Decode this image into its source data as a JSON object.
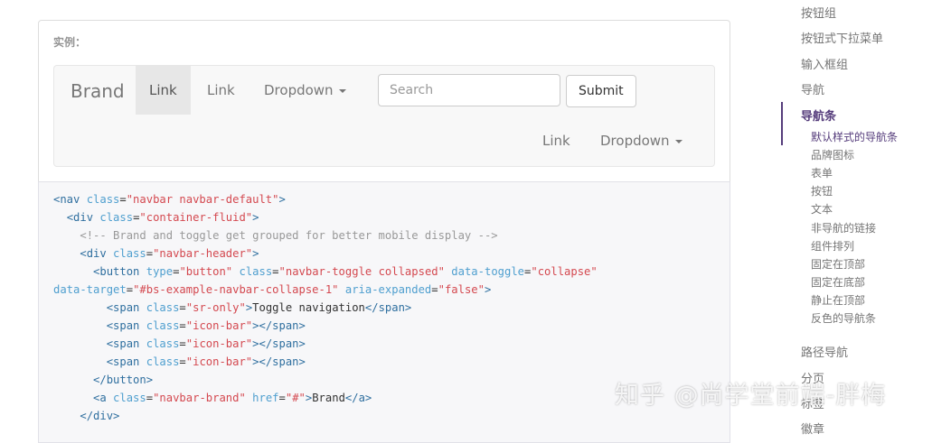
{
  "example": {
    "label": "实例：",
    "navbar": {
      "brand": "Brand",
      "links": [
        "Link",
        "Link"
      ],
      "dropdown": "Dropdown",
      "search_placeholder": "Search",
      "submit": "Submit",
      "right_link": "Link",
      "right_dropdown": "Dropdown"
    }
  },
  "code": {
    "l1": {
      "a": "<nav ",
      "b": "class",
      "c": "=",
      "d": "\"navbar navbar-default\"",
      "e": ">"
    },
    "l2": {
      "a": "<div ",
      "b": "class",
      "c": "=",
      "d": "\"container-fluid\"",
      "e": ">"
    },
    "l3": "<!-- Brand and toggle get grouped for better mobile display -->",
    "l4": {
      "a": "<div ",
      "b": "class",
      "c": "=",
      "d": "\"navbar-header\"",
      "e": ">"
    },
    "l5": {
      "a": "<button ",
      "b1": "type",
      "d1": "\"button\"",
      "b2": "class",
      "d2": "\"navbar-toggle collapsed\"",
      "b3": "data-toggle",
      "d3": "\"collapse\""
    },
    "l6": {
      "b1": "data-target",
      "d1": "\"#bs-example-navbar-collapse-1\"",
      "b2": "aria-expanded",
      "d2": "\"false\"",
      "e": ">"
    },
    "l7": {
      "a": "<span ",
      "b": "class",
      "d": "\"sr-only\"",
      "e": ">",
      "text": "Toggle navigation",
      "f": "</span>"
    },
    "l8": {
      "a": "<span ",
      "b": "class",
      "d": "\"icon-bar\"",
      "e": "></span>"
    },
    "l9": {
      "a": "<span ",
      "b": "class",
      "d": "\"icon-bar\"",
      "e": "></span>"
    },
    "l10": {
      "a": "<span ",
      "b": "class",
      "d": "\"icon-bar\"",
      "e": "></span>"
    },
    "l11": "</button>",
    "l12": {
      "a": "<a ",
      "b1": "class",
      "d1": "\"navbar-brand\"",
      "b2": "href",
      "d2": "\"#\"",
      "e": ">",
      "text": "Brand",
      "f": "</a>"
    },
    "l13": "</div>"
  },
  "sidebar": {
    "top_items": [
      "按钮组",
      "按钮式下拉菜单",
      "输入框组",
      "导航"
    ],
    "active_item": "导航条",
    "sub_items": [
      "默认样式的导航条",
      "品牌图标",
      "表单",
      "按钮",
      "文本",
      "非导航的链接",
      "组件排列",
      "固定在顶部",
      "固定在底部",
      "静止在顶部",
      "反色的导航条"
    ],
    "bottom_items": [
      "路径导航",
      "分页",
      "标签",
      "徽章"
    ]
  },
  "watermark": "知乎 @尚学堂前端-胖梅",
  "colors": {
    "accent": "#563d7c",
    "tag": "#2f6f9f",
    "attr": "#4f9fcf",
    "string": "#d44950",
    "comment": "#999999"
  }
}
